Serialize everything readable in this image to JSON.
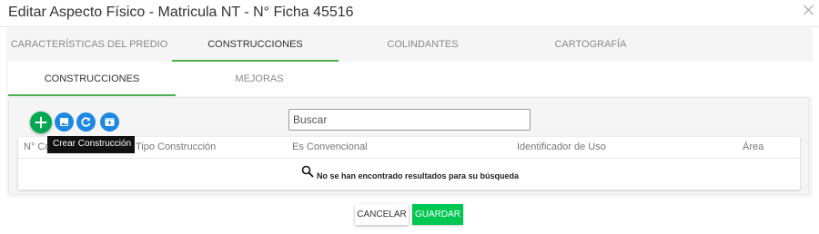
{
  "modal": {
    "title": "Editar Aspecto Físico - Matricula NT - N° Ficha 45516"
  },
  "outer_tabs": [
    {
      "label": "CARACTERÍSTICAS DEL PREDIO",
      "active": false
    },
    {
      "label": "CONSTRUCCIONES",
      "active": true
    },
    {
      "label": "COLINDANTES",
      "active": false
    },
    {
      "label": "CARTOGRAFÍA",
      "active": false
    }
  ],
  "inner_tabs": [
    {
      "label": "CONSTRUCCIONES",
      "active": true
    },
    {
      "label": "MEJORAS",
      "active": false
    }
  ],
  "toolbar": {
    "icons": [
      "add-icon",
      "image-icon",
      "refresh-icon",
      "archive-icon"
    ],
    "tooltip": "Crear Construcción",
    "colors": {
      "add": "#00a84f",
      "secondary": "#1e88e5"
    }
  },
  "search": {
    "placeholder": "Buscar",
    "value": ""
  },
  "table": {
    "columns": [
      "N° Co",
      "Tipo Construcción",
      "Es Convencional",
      "Identificador de Uso",
      "Área"
    ],
    "empty_message": "No se han encontrado resultados para su búsqueda"
  },
  "footer": {
    "cancel_label": "CANCELAR",
    "save_label": "GUARDAR"
  },
  "colors": {
    "accent": "#4caf50",
    "save_button": "#00c853",
    "panel_bg": "#f5f5f5"
  }
}
